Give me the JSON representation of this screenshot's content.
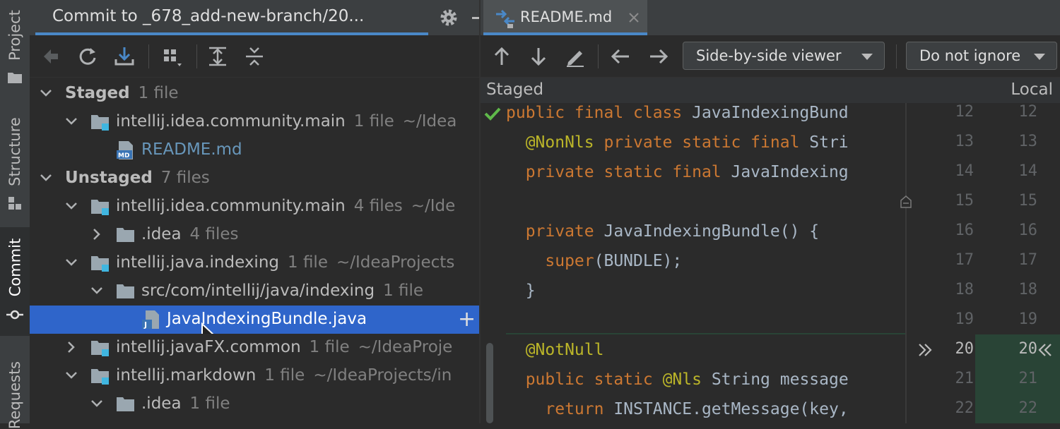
{
  "sidebar": {
    "tabs": [
      {
        "label": "Project"
      },
      {
        "label": "Structure"
      },
      {
        "label": "Commit"
      },
      {
        "label": "Requests"
      }
    ]
  },
  "commit_panel": {
    "title": "Commit to _678_add-new-branch/20...",
    "tree": {
      "staged": {
        "label": "Staged",
        "count": "1 file"
      },
      "staged_module": {
        "label": "intellij.idea.community.main",
        "count": "1 file",
        "path": "~/Idea"
      },
      "staged_file": {
        "label": "README.md"
      },
      "unstaged": {
        "label": "Unstaged",
        "count": "7 files"
      },
      "unstaged_module1": {
        "label": "intellij.idea.community.main",
        "count": "4 files",
        "path": "~/Ide"
      },
      "idea_folder": {
        "label": ".idea",
        "count": "4 files"
      },
      "java_indexing": {
        "label": "intellij.java.indexing",
        "count": "1 file",
        "path": "~/IdeaProjects"
      },
      "src_folder": {
        "label": "src/com/intellij/java/indexing",
        "count": "1 file"
      },
      "selected_file": {
        "label": "JavaIndexingBundle.java",
        "action": "+"
      },
      "javafx": {
        "label": "intellij.javaFX.common",
        "count": "1 file",
        "path": "~/IdeaProje"
      },
      "markdown": {
        "label": "intellij.markdown",
        "count": "1 file",
        "path": "~/IdeaProjects/in"
      },
      "idea_folder2": {
        "label": ".idea",
        "count": "1 file"
      }
    }
  },
  "diff_panel": {
    "tab": {
      "label": "README.md"
    },
    "viewer_dropdown": {
      "value": "Side-by-side viewer"
    },
    "ignore_dropdown": {
      "value": "Do not ignore"
    },
    "left_header": "Staged",
    "right_header": "Local",
    "line_numbers": [
      "12",
      "13",
      "14",
      "15",
      "16",
      "17",
      "18",
      "19",
      "20",
      "21",
      "22"
    ],
    "code": {
      "l1a": "public final class",
      "l1b": " JavaIndexingBund",
      "l2a": "  @NonNls",
      "l2b": " private static final",
      "l2c": " Stri",
      "l3a": "  private static final",
      "l3b": " JavaIndexing",
      "l5a": "  private",
      "l5b": " JavaIndexingBundle",
      "l5c": "() {",
      "l6a": "    super",
      "l6b": "(BUNDLE);",
      "l7": "  }",
      "l9": "  @NotNull",
      "l10a": "  public static",
      "l10b": " @Nls",
      "l10c": " String message",
      "l11a": "    return",
      "l11b": " INSTANCE.getMessage(key,"
    }
  },
  "colors": {
    "accent": "#4a88c7",
    "selection": "#2f65ca",
    "added_bg": "#294436",
    "check": "#5fb94a"
  }
}
